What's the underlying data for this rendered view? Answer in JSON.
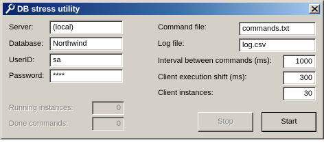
{
  "window": {
    "title": "DB stress utility",
    "icons": {
      "title": "wrench-icon",
      "close": "close-x-icon"
    }
  },
  "connection": {
    "server_label": "Server:",
    "server_value": "(local)",
    "database_label": "Database:",
    "database_value": "Northwind",
    "userid_label": "UserID:",
    "userid_value": "sa",
    "password_label": "Password:",
    "password_value": "****"
  },
  "files": {
    "command_file_label": "Command file:",
    "command_file_value": "commands.txt",
    "log_file_label": "Log file:",
    "log_file_value": "log.csv"
  },
  "settings": {
    "interval_label": "Interval between commands (ms):",
    "interval_value": "1000",
    "shift_label": "Client execution shift (ms):",
    "shift_value": "300",
    "instances_label": "Client instances:",
    "instances_value": "30"
  },
  "status": {
    "running_label": "Running instances:",
    "running_value": "0",
    "done_label": "Done commands:",
    "done_value": "0"
  },
  "actions": {
    "stop_label": "Stop",
    "start_label": "Start"
  },
  "colors": {
    "face": "#d4d0c8",
    "title_start": "#0a246a",
    "title_end": "#a6caf0",
    "disabled_text": "#808080"
  }
}
